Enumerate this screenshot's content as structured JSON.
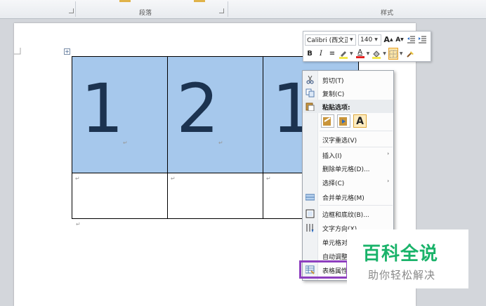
{
  "ribbon": {
    "paragraph_label": "段落",
    "styles_label": "样式"
  },
  "table": {
    "row1": [
      "1",
      "2",
      "1"
    ],
    "cell_mark": "↵"
  },
  "mini_toolbar": {
    "font_name": "Calibri (西文正",
    "font_size": "140",
    "grow_font": "A",
    "shrink_font": "A",
    "bold": "B",
    "italic": "I",
    "align": "≡",
    "font_color_letter": "A",
    "highlight_color": "#f2e84b",
    "font_color": "#e02020"
  },
  "context_menu": {
    "items": [
      {
        "label": "剪切(T)",
        "icon": "scissors-icon"
      },
      {
        "label": "复制(C)",
        "icon": "copy-icon"
      },
      {
        "label": "粘贴选项:",
        "icon": "paste-icon"
      },
      {
        "label": "汉字重选(V)"
      },
      {
        "label": "插入(I)",
        "submenu": "›"
      },
      {
        "label": "删除单元格(D)..."
      },
      {
        "label": "选择(C)",
        "submenu": "›"
      },
      {
        "label": "合并单元格(M)",
        "icon": "merge-cells-icon"
      },
      {
        "label": "边框和底纹(B)...",
        "icon": "borders-icon"
      },
      {
        "label": "文字方向(X)...",
        "icon": "text-direction-icon"
      },
      {
        "label": "单元格对齐方式(G)",
        "submenu": "›"
      },
      {
        "label": "自动调整(A)",
        "submenu": "›"
      },
      {
        "label": "表格属性(R)...",
        "icon": "table-properties-icon"
      }
    ],
    "paste_option_text": "A"
  },
  "watermark": {
    "title": "百科全说",
    "subtitle": "助你轻松解决"
  }
}
